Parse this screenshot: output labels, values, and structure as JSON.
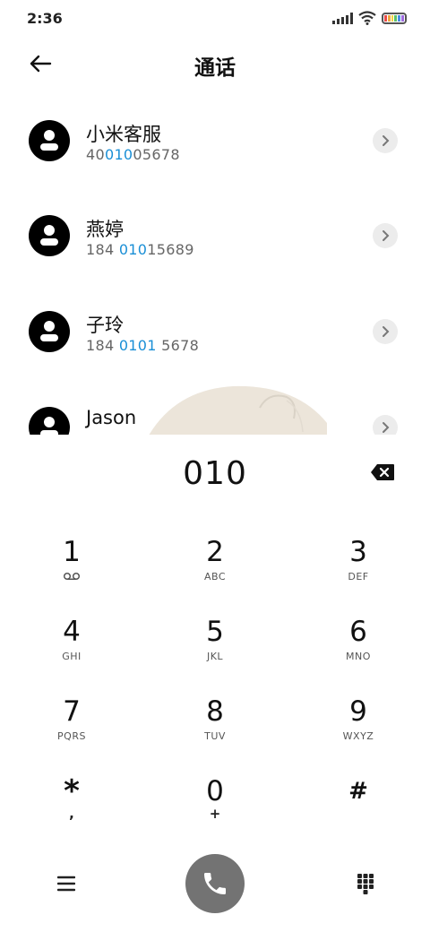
{
  "status_bar": {
    "time": "2:36",
    "signal_icon": "cellular-signal-icon",
    "wifi_icon": "wifi-icon",
    "battery_icon": "battery-icon"
  },
  "header": {
    "title": "通话",
    "back_icon": "arrow-left-icon"
  },
  "contacts": [
    {
      "name": "小米客服",
      "number_parts": [
        "40",
        "010",
        "05678"
      ]
    },
    {
      "name": "燕婷",
      "number_parts": [
        "184 ",
        "010",
        "15689"
      ]
    },
    {
      "name": "子玲",
      "number_parts": [
        "184 ",
        "0101",
        " 5678"
      ]
    },
    {
      "name": "Jason",
      "number_parts": [
        "",
        "",
        ""
      ]
    }
  ],
  "dialer": {
    "number": "010",
    "backspace_icon": "backspace-icon"
  },
  "keys": [
    {
      "digit": "1",
      "letters": "",
      "icon": "voicemail-icon"
    },
    {
      "digit": "2",
      "letters": "ABC"
    },
    {
      "digit": "3",
      "letters": "DEF"
    },
    {
      "digit": "4",
      "letters": "GHI"
    },
    {
      "digit": "5",
      "letters": "JKL"
    },
    {
      "digit": "6",
      "letters": "MNO"
    },
    {
      "digit": "7",
      "letters": "PQRS"
    },
    {
      "digit": "8",
      "letters": "TUV"
    },
    {
      "digit": "9",
      "letters": "WXYZ"
    },
    {
      "digit": "*",
      "letters": ","
    },
    {
      "digit": "0",
      "letters": "+"
    },
    {
      "digit": "#",
      "letters": ""
    }
  ],
  "bottom_bar": {
    "menu_icon": "menu-icon",
    "call_icon": "phone-call-icon",
    "keypad_icon": "dialpad-icon"
  },
  "colors": {
    "highlight": "#1a8fd6",
    "call_button": "#737373",
    "chevron_bg": "#ececec"
  }
}
